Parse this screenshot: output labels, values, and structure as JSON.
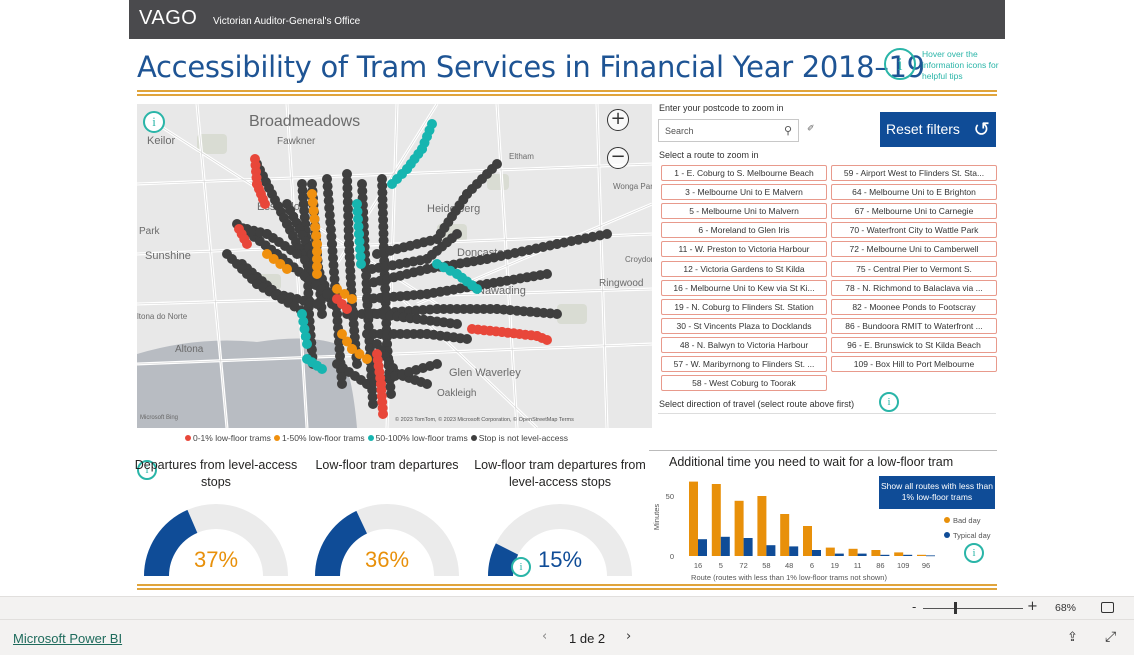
{
  "header": {
    "logo": "VAGO",
    "org": "Victorian Auditor-General's Office"
  },
  "title": "Accessibility of Tram Services in Financial Year 2018–19",
  "hover_tip": {
    "icon": "info-icon",
    "text": "Hover over the information icons for helpful tips"
  },
  "map": {
    "legend": [
      {
        "label": "0-1% low-floor trams",
        "color": "#e8473a"
      },
      {
        "label": "1-50% low-floor trams",
        "color": "#f0900e"
      },
      {
        "label": "50-100% low-floor trams",
        "color": "#17b5b0"
      },
      {
        "label": "Stop is not level-access",
        "color": "#3f3f3f"
      }
    ],
    "attribution": "© 2023 TomTom, © 2023 Microsoft Corporation, © OpenStreetMap  Terms",
    "bing": "Microsoft Bing",
    "places": [
      "Broadmeadows",
      "Fawkner",
      "Keilor",
      "Essendon",
      "Sunshine",
      "Heidelberg",
      "Doncaster",
      "Ringwood",
      "Glen Waverley",
      "Oakleigh",
      "Altona",
      "Eltham",
      "Wonga Park",
      "Croydon",
      "Park",
      "ltona do Norte",
      "Nawading"
    ]
  },
  "postcode": {
    "label": "Enter your postcode to zoom in",
    "placeholder": "Search"
  },
  "reset_label": "Reset filters",
  "routes_label": "Select a route to zoom in",
  "routes": [
    "1 - E. Coburg to S. Melbourne Beach",
    "59 - Airport West to Flinders St. Sta...",
    "3 - Melbourne Uni to E Malvern",
    "64 - Melbourne Uni to E Brighton",
    "5 - Melbourne Uni to Malvern",
    "67 - Melbourne Uni to Carnegie",
    "6 - Moreland to Glen Iris",
    "70 - Waterfront City to Wattle Park",
    "11 - W. Preston to Victoria Harbour",
    "72 - Melbourne Uni to Camberwell",
    "12 - Victoria Gardens to St Kilda",
    "75 - Central Pier to Vermont S.",
    "16 - Melbourne Uni to Kew via St Ki...",
    "78 - N. Richmond to Balaclava via ...",
    "19 - N. Coburg to Flinders St. Station",
    "82 - Moonee Ponds to Footscray",
    "30 - St Vincents Plaza to Docklands",
    "86 - Bundoora RMIT to Waterfront ...",
    "48 - N. Balwyn to Victoria Harbour",
    "96 - E. Brunswick to St Kilda Beach",
    "57 - W. Maribyrnong to Flinders St. ...",
    "109 - Box Hill to Port Melbourne",
    "58 - West Coburg to Toorak"
  ],
  "direction_label": "Select direction of travel (select route above first)",
  "gauges": [
    {
      "title": "Departures from level-access stops",
      "value_text": "37%",
      "fraction": 0.37
    },
    {
      "title": "Low-floor tram departures",
      "value_text": "36%",
      "fraction": 0.36
    },
    {
      "title": "Low-floor tram departures from level-access stops",
      "value_text": "15%",
      "fraction": 0.15
    }
  ],
  "colors": {
    "brand_blue": "#0f4c97",
    "gauge_blue": "#0f4c97",
    "gauge_track": "#ebebeb",
    "orange": "#e8900a",
    "teal": "#2ab5a8",
    "gold": "#e0a43b"
  },
  "chart_data": {
    "type": "bar",
    "title": "Additional time you need to wait for a low-floor tram",
    "xlabel": "Route (routes with less than 1% low-floor trams not shown)",
    "ylabel": "Minutes",
    "categories": [
      "16",
      "5",
      "72",
      "58",
      "48",
      "6",
      "19",
      "11",
      "86",
      "109",
      "96"
    ],
    "yticks": [
      0,
      50
    ],
    "ylim": [
      0,
      65
    ],
    "series": [
      {
        "name": "Bad day",
        "color": "#e8900a",
        "values": [
          62,
          60,
          46,
          50,
          35,
          25,
          7,
          6,
          5,
          3,
          1
        ]
      },
      {
        "name": "Typical day",
        "color": "#0f4c97",
        "values": [
          14,
          16,
          15,
          9,
          8,
          5,
          2,
          2,
          1,
          1,
          0.5
        ]
      }
    ],
    "legend_position": "right"
  },
  "show_button": "Show all routes with less than 1% low-floor trams",
  "bottom": {
    "zoom_minus": "-",
    "zoom_plus": "+",
    "zoom_pct": "68%",
    "powerbi": "Microsoft Power BI",
    "page": "1 de 2"
  }
}
